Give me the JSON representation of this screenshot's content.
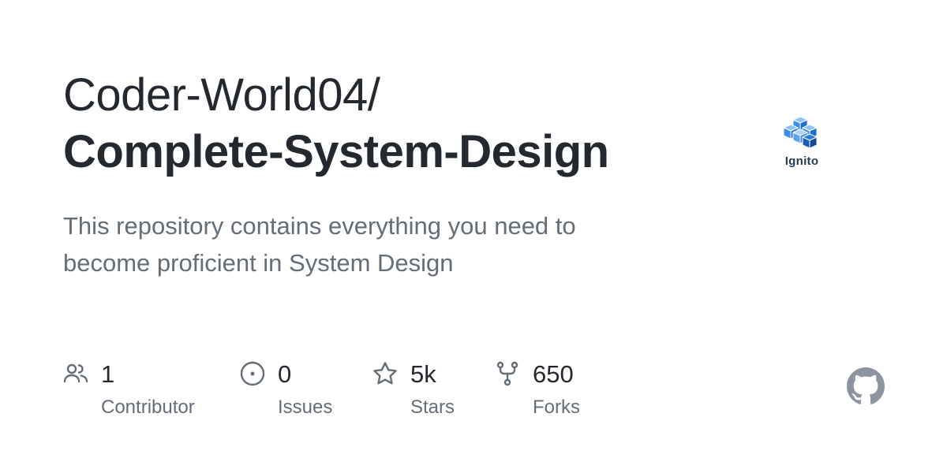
{
  "repository": {
    "owner": "Coder-World04/",
    "name": "Complete-System-Design",
    "description": "This repository contains everything you need to become proficient in System Design"
  },
  "org_logo": {
    "label": "Ignito",
    "icon": "stacked-cubes-icon",
    "color": "#3b8eea"
  },
  "stats": [
    {
      "icon": "people-icon",
      "value": "1",
      "label": "Contributor"
    },
    {
      "icon": "issue-circle-icon",
      "value": "0",
      "label": "Issues"
    },
    {
      "icon": "star-icon",
      "value": "5k",
      "label": "Stars"
    },
    {
      "icon": "fork-icon",
      "value": "650",
      "label": "Forks"
    }
  ],
  "colors": {
    "title": "#24292f",
    "muted": "#656d76",
    "icon": "#656d76",
    "github_mark": "#8c959f"
  },
  "github_mark_icon": "github-mark-icon"
}
